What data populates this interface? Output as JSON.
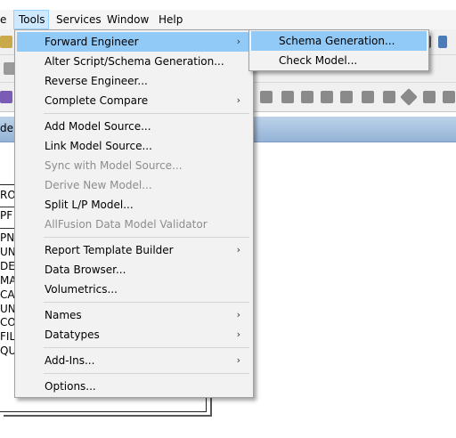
{
  "menubar": {
    "items": [
      {
        "label": "e"
      },
      {
        "label": "Tools"
      },
      {
        "label": "Services"
      },
      {
        "label": "Window"
      },
      {
        "label": "Help"
      }
    ]
  },
  "diagram": {
    "tab_label": "de",
    "entity": {
      "name": "RO",
      "primary_key": "PF",
      "attributes": [
        "PN",
        "UN",
        "DE",
        "MA",
        "CA",
        "UN",
        "CO",
        "FIL",
        "QU"
      ]
    }
  },
  "tools_menu": {
    "items": [
      {
        "label": "Forward Engineer",
        "submenu": true,
        "highlighted": true
      },
      {
        "label": "Alter Script/Schema Generation..."
      },
      {
        "label": "Reverse Engineer..."
      },
      {
        "label": "Complete Compare",
        "submenu": true
      },
      {
        "label": "Add Model Source..."
      },
      {
        "label": "Link Model Source..."
      },
      {
        "label": "Sync with Model Source...",
        "disabled": true
      },
      {
        "label": "Derive New Model...",
        "disabled": true
      },
      {
        "label": "Split L/P Model..."
      },
      {
        "label": "AllFusion Data Model Validator",
        "disabled": true
      },
      {
        "label": "Report Template Builder",
        "submenu": true
      },
      {
        "label": "Data Browser..."
      },
      {
        "label": "Volumetrics..."
      },
      {
        "label": "Names",
        "submenu": true
      },
      {
        "label": "Datatypes",
        "submenu": true
      },
      {
        "label": "Add-Ins...",
        "submenu": true
      },
      {
        "label": "Options..."
      }
    ],
    "submenu_arrow": "›"
  },
  "forward_engineer_submenu": {
    "items": [
      {
        "label": "Schema Generation...",
        "highlighted": true
      },
      {
        "label": "Check Model..."
      }
    ]
  },
  "colors": {
    "menu_bg": "#f2f2f2",
    "highlight": "#91c9f7",
    "disabled_text": "#8d8d8d",
    "diagram_tab": "#a9c3e0"
  }
}
